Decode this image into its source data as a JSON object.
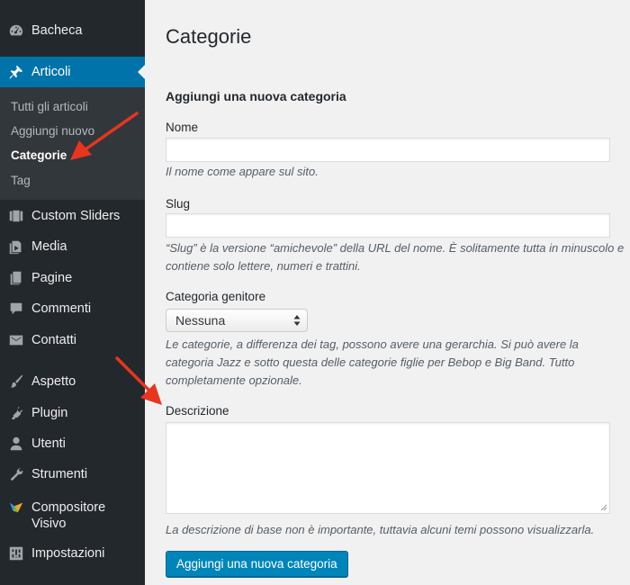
{
  "sidebar": {
    "items": [
      {
        "label": "Bacheca",
        "icon": "dashboard-icon"
      },
      {
        "label": "Articoli",
        "icon": "pushpin-icon"
      },
      {
        "label": "Custom Sliders",
        "icon": "slides-icon"
      },
      {
        "label": "Media",
        "icon": "media-icon"
      },
      {
        "label": "Pagine",
        "icon": "page-icon"
      },
      {
        "label": "Commenti",
        "icon": "comment-icon"
      },
      {
        "label": "Contatti",
        "icon": "envelope-icon"
      },
      {
        "label": "Aspetto",
        "icon": "paintbrush-icon"
      },
      {
        "label": "Plugin",
        "icon": "plug-icon"
      },
      {
        "label": "Utenti",
        "icon": "user-icon"
      },
      {
        "label": "Strumenti",
        "icon": "wrench-icon"
      },
      {
        "label": "Compositore Visivo",
        "icon": "visual-composer-icon"
      },
      {
        "label": "Impostazioni",
        "icon": "settings-icon"
      }
    ],
    "submenu": [
      {
        "label": "Tutti gli articoli"
      },
      {
        "label": "Aggiungi nuovo"
      },
      {
        "label": "Categorie"
      },
      {
        "label": "Tag"
      }
    ]
  },
  "main": {
    "title": "Categorie",
    "form_title": "Aggiungi una nuova categoria",
    "name_label": "Nome",
    "name_value": "",
    "name_help": "Il nome come appare sul sito.",
    "slug_label": "Slug",
    "slug_value": "",
    "slug_help": "“Slug” è la versione “amichevole” della URL del nome. È solitamente tutta in minuscolo e contiene solo lettere, numeri e trattini.",
    "parent_label": "Categoria genitore",
    "parent_selected": "Nessuna",
    "parent_help": "Le categorie, a differenza dei tag, possono avere una gerarchia. Si può avere la categoria Jazz e sotto questa delle categorie figlie per Bebop e Big Band. Tutto completamente opzionale.",
    "description_label": "Descrizione",
    "description_value": "",
    "description_help": "La descrizione di base non è importante, tuttavia alcuni temi possono visualizzarla.",
    "submit_label": "Aggiungi una nuova categoria"
  },
  "colors": {
    "sidebar_bg": "#23282d",
    "submenu_bg": "#32373c",
    "accent": "#0073aa",
    "button": "#0085ba",
    "annotation_arrow": "#e8351e"
  }
}
